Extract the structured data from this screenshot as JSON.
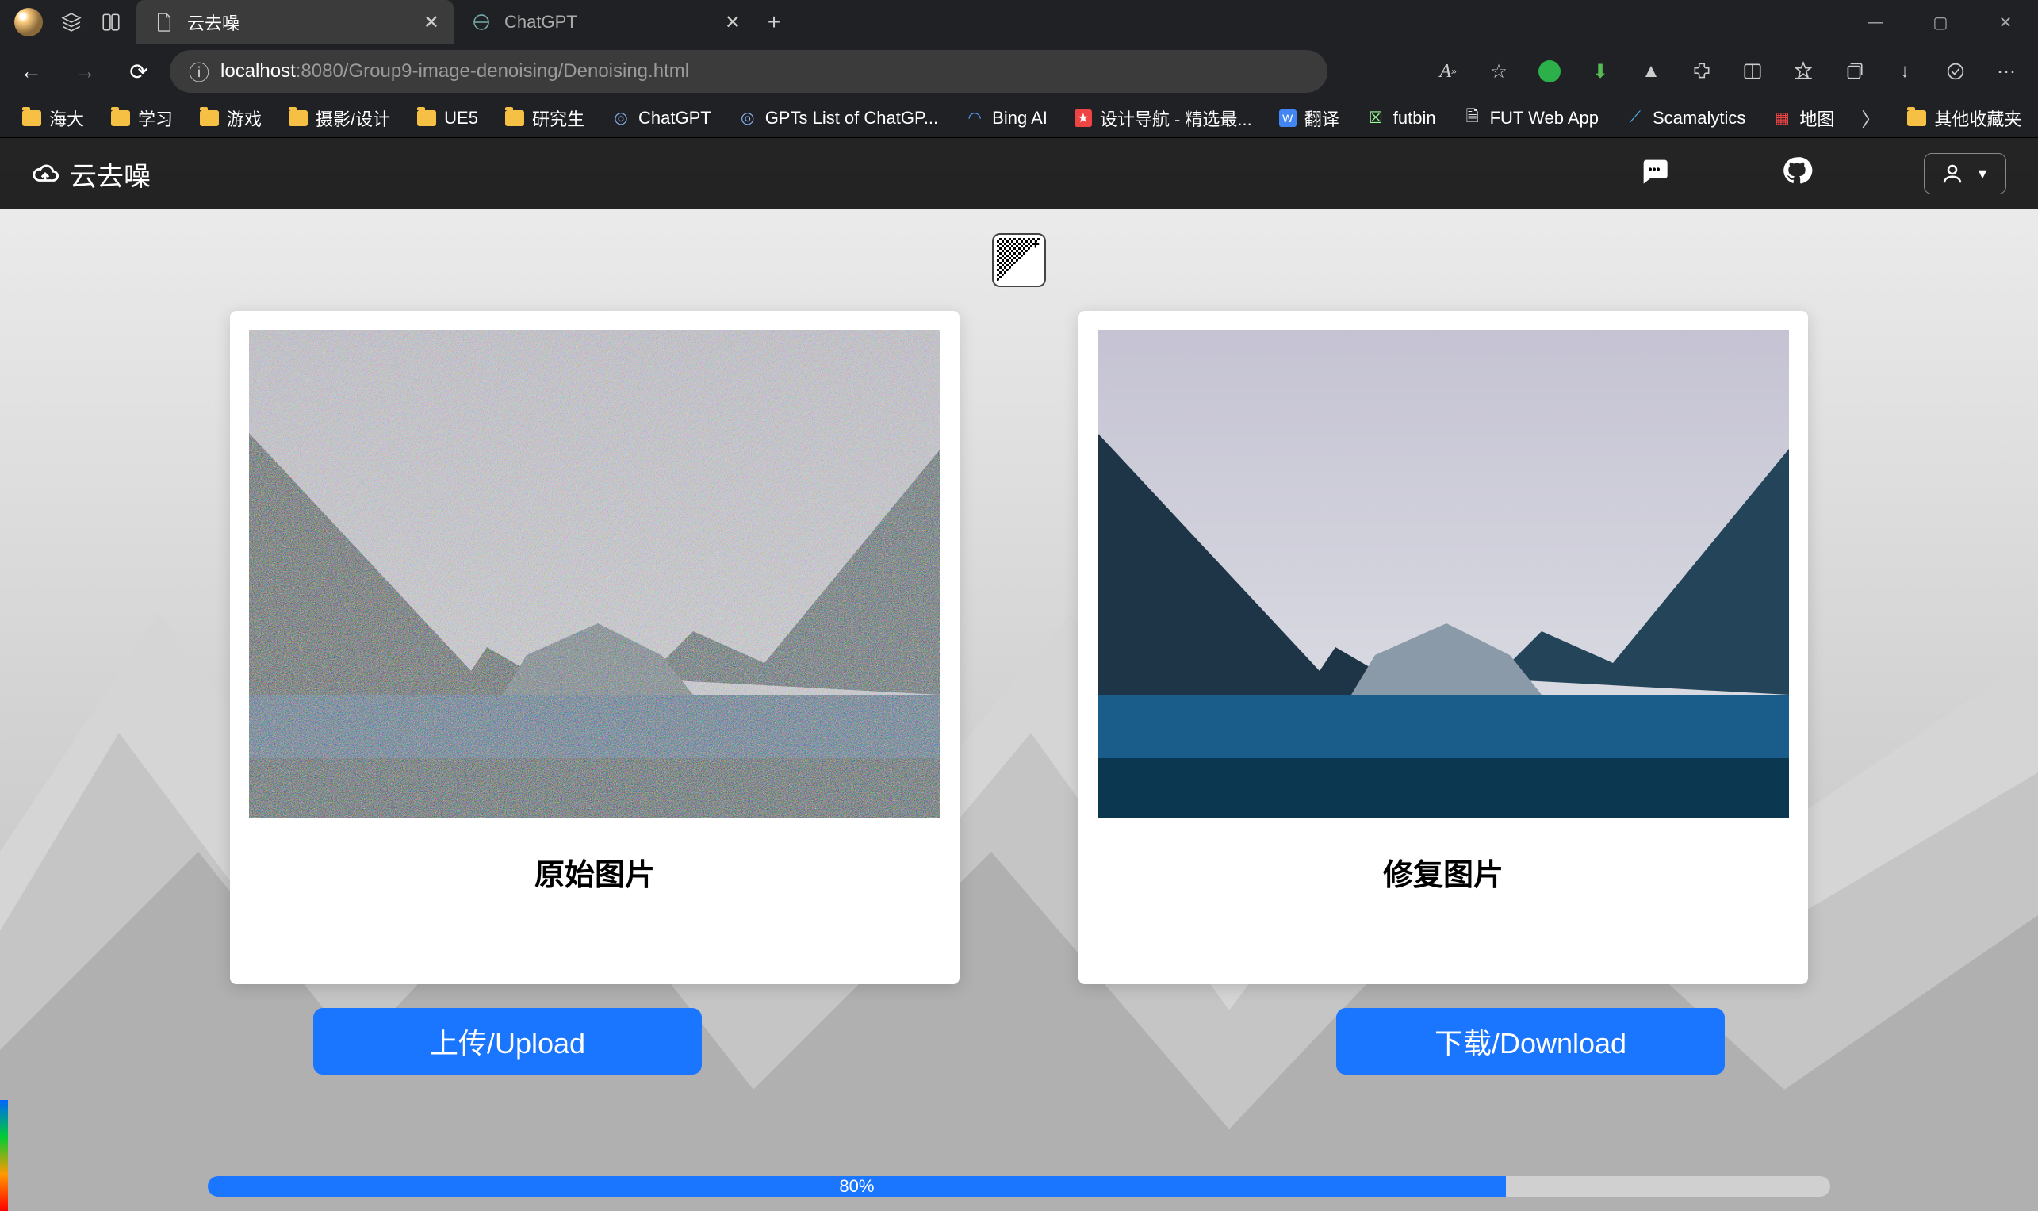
{
  "window": {
    "tabs": [
      {
        "title": "云去噪",
        "active": true,
        "favicon": "file"
      },
      {
        "title": "ChatGPT",
        "active": false,
        "favicon": "openai"
      }
    ],
    "address": {
      "host": "localhost",
      "path": ":8080/Group9-image-denoising/Denoising.html"
    }
  },
  "bookmarks": [
    {
      "label": "海大",
      "type": "folder"
    },
    {
      "label": "学习",
      "type": "folder"
    },
    {
      "label": "游戏",
      "type": "folder"
    },
    {
      "label": "摄影/设计",
      "type": "folder"
    },
    {
      "label": "UE5",
      "type": "folder"
    },
    {
      "label": "研究生",
      "type": "folder"
    },
    {
      "label": "ChatGPT",
      "type": "link",
      "icon": "G"
    },
    {
      "label": "GPTs List of ChatGP...",
      "type": "link",
      "icon": "G"
    },
    {
      "label": "Bing AI",
      "type": "link",
      "icon": "◠"
    },
    {
      "label": "设计导航 - 精选最...",
      "type": "link",
      "icon": "★"
    },
    {
      "label": "翻译",
      "type": "link",
      "icon": "W"
    },
    {
      "label": "futbin",
      "type": "link",
      "icon": "☒"
    },
    {
      "label": "FUT Web App",
      "type": "link",
      "icon": "🗎"
    },
    {
      "label": "Scamalytics",
      "type": "link",
      "icon": "⟋"
    },
    {
      "label": "地图",
      "type": "link",
      "icon": "▦"
    },
    {
      "label": "其他收藏夹",
      "type": "folder",
      "right": true
    }
  ],
  "app": {
    "brand": "云去噪",
    "cards": {
      "original": {
        "title": "原始图片"
      },
      "restored": {
        "title": "修复图片"
      }
    },
    "buttons": {
      "upload": "上传/Upload",
      "download": "下载/Download"
    },
    "progress": {
      "percent": 80,
      "label": "80%"
    }
  }
}
